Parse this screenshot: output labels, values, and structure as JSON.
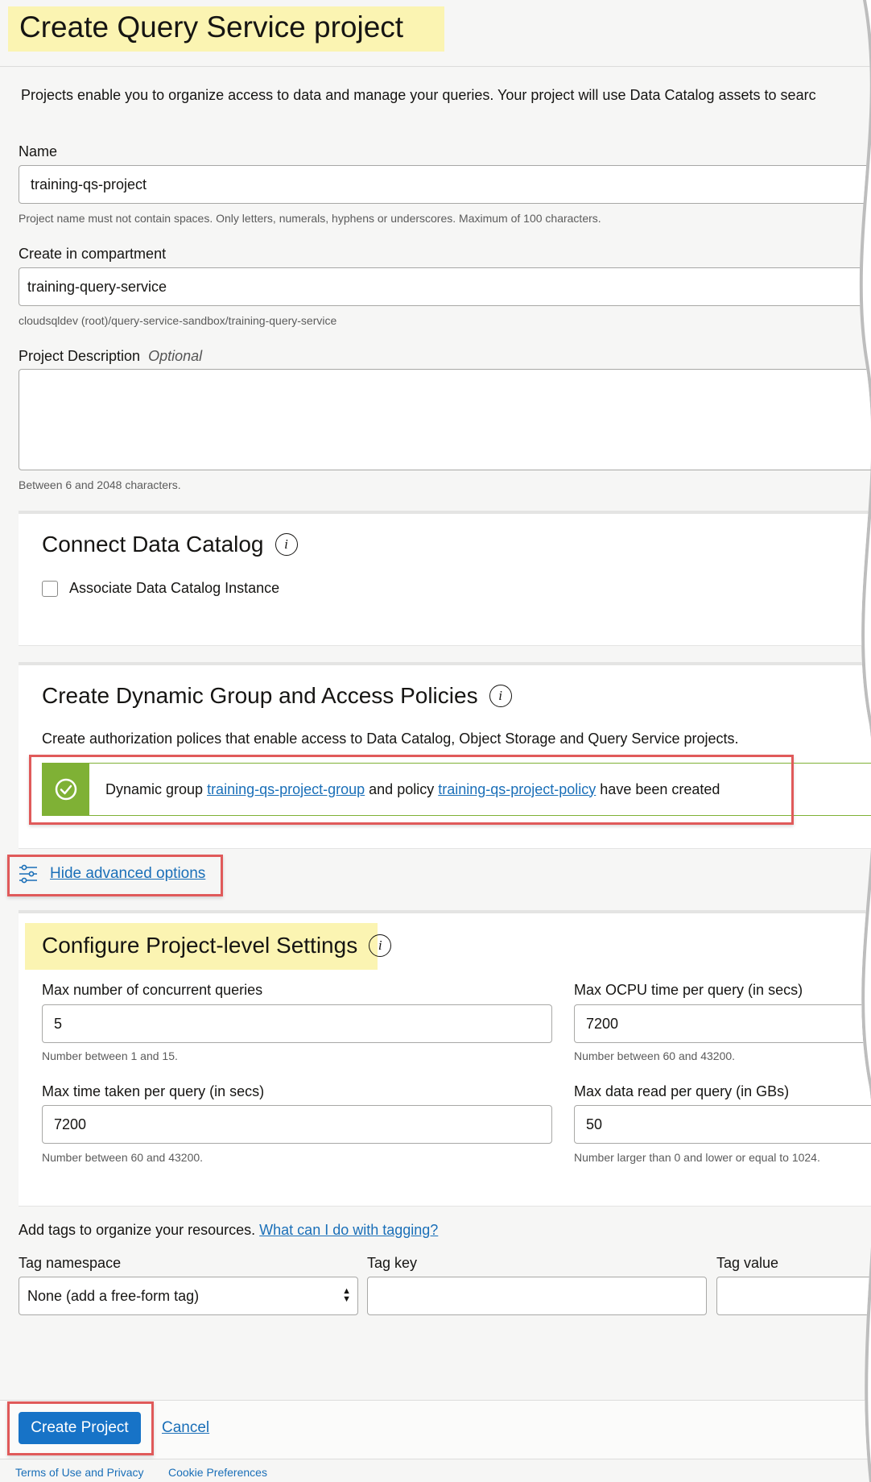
{
  "page": {
    "title": "Create Query Service project",
    "intro": "Projects enable you to organize access to data and manage your queries. Your project will use Data Catalog assets to searc"
  },
  "name": {
    "label": "Name",
    "value": "training-qs-project",
    "hint": "Project name must not contain spaces. Only letters, numerals, hyphens or underscores. Maximum of 100 characters."
  },
  "compartment": {
    "label": "Create in compartment",
    "value": "training-query-service",
    "path": "cloudsqldev (root)/query-service-sandbox/training-query-service"
  },
  "description": {
    "label": "Project Description",
    "optional": "Optional",
    "value": "",
    "hint": "Between 6 and 2048 characters."
  },
  "catalog": {
    "title": "Connect Data Catalog",
    "info_icon": "i",
    "checkbox_label": "Associate Data Catalog Instance"
  },
  "dynamic_group": {
    "title": "Create Dynamic Group and Access Policies",
    "info_icon": "i",
    "description": "Create authorization polices that enable access to Data Catalog, Object Storage and Query Service projects.",
    "success": {
      "prefix": "Dynamic group ",
      "group_link": "training-qs-project-group",
      "middle": " and policy ",
      "policy_link": "training-qs-project-policy",
      "suffix": " have been created"
    }
  },
  "advanced": {
    "toggle_label": "Hide advanced options"
  },
  "settings": {
    "title": "Configure Project-level Settings",
    "info_icon": "i",
    "fields": [
      {
        "label": "Max number of concurrent queries",
        "value": "5",
        "hint": "Number between 1 and 15."
      },
      {
        "label": "Max OCPU time per query (in secs)",
        "value": "7200",
        "hint": "Number between 60 and 43200."
      },
      {
        "label": "Max time taken per query (in secs)",
        "value": "7200",
        "hint": "Number between 60 and 43200."
      },
      {
        "label": "Max data read per query (in GBs)",
        "value": "50",
        "hint": "Number larger than 0 and lower or equal to 1024."
      }
    ]
  },
  "tags": {
    "intro": "Add tags to organize your resources. ",
    "help_link": "What can I do with tagging?",
    "namespace_label": "Tag namespace",
    "namespace_value": "None (add a free-form tag)",
    "key_label": "Tag key",
    "key_value": "",
    "value_label": "Tag value",
    "value_value": ""
  },
  "actions": {
    "create": "Create Project",
    "cancel": "Cancel"
  },
  "footer": {
    "terms": "Terms of Use and Privacy",
    "cookies": "Cookie Preferences"
  },
  "colors": {
    "primary": "#1773c7",
    "success": "#7fb135",
    "highlight": "#fbf4b2",
    "annotation_red": "#e05a5a",
    "link": "#1a6fb8"
  }
}
